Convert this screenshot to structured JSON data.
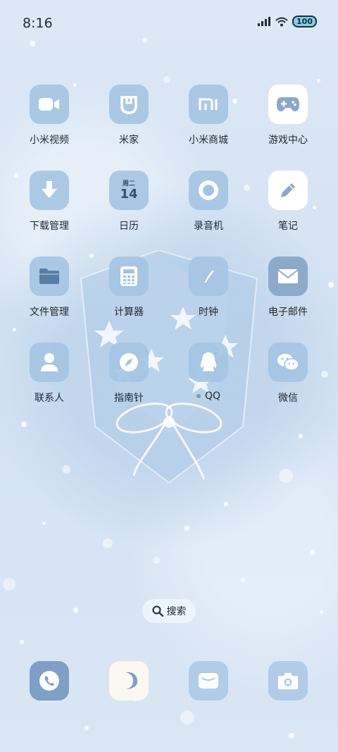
{
  "status_bar": {
    "time": "8:16",
    "battery": "100",
    "icons": [
      "signal-icon",
      "wifi-icon",
      "battery-icon"
    ]
  },
  "apps": [
    {
      "label": "小米视频",
      "icon": "video-icon"
    },
    {
      "label": "米家",
      "icon": "mijia-icon"
    },
    {
      "label": "小米商城",
      "icon": "mi-store-icon"
    },
    {
      "label": "游戏中心",
      "icon": "gamepad-icon"
    },
    {
      "label": "下载管理",
      "icon": "download-icon"
    },
    {
      "label": "日历",
      "icon": "calendar-icon",
      "day_label": "周二",
      "date": "14"
    },
    {
      "label": "录音机",
      "icon": "recorder-icon"
    },
    {
      "label": "笔记",
      "icon": "pencil-icon"
    },
    {
      "label": "文件管理",
      "icon": "folder-icon"
    },
    {
      "label": "计算器",
      "icon": "calculator-icon"
    },
    {
      "label": "时钟",
      "icon": "clock-icon"
    },
    {
      "label": "电子邮件",
      "icon": "mail-icon"
    },
    {
      "label": "联系人",
      "icon": "contact-icon"
    },
    {
      "label": "指南针",
      "icon": "compass-icon"
    },
    {
      "label": "QQ",
      "icon": "qq-icon"
    },
    {
      "label": "微信",
      "icon": "wechat-icon"
    }
  ],
  "search": {
    "label": "搜索"
  },
  "dock": [
    {
      "icon": "phone-icon"
    },
    {
      "icon": "moon-icon"
    },
    {
      "icon": "message-icon"
    },
    {
      "icon": "camera-icon"
    }
  ],
  "colors": {
    "wallpaper": "#d9e6f4",
    "tile": "#a4c4e2",
    "tile_dark": "#8eaacb",
    "icon_white": "#ffffff",
    "text": "#1f2730"
  }
}
